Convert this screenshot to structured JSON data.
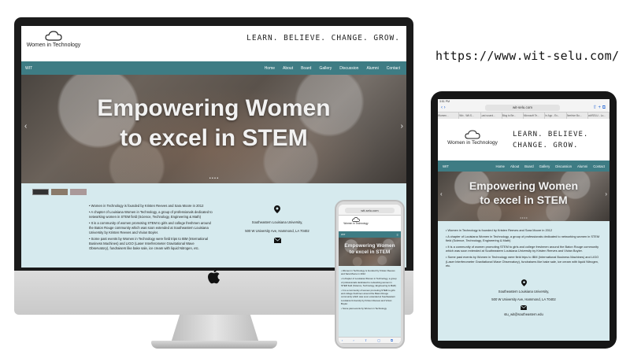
{
  "url": "https://www.wit-selu.com/",
  "site": {
    "logo_text": "Women in Technology",
    "tagline": "LEARN. BELIEVE. CHANGE. GROW.",
    "tagline_line1": "LEARN. BELIEVE.",
    "tagline_line2": "CHANGE. GROW.",
    "nav_brand": "WIT",
    "nav": [
      "Home",
      "About",
      "Board",
      "Gallery",
      "Discussion",
      "Alumni",
      "Contact"
    ],
    "hero_line1": "Empowering Women",
    "hero_line2": "to excel in STEM",
    "hero_prev": "‹",
    "hero_next": "›",
    "hero_dots": "• • • •",
    "bullets": [
      "Women in Technology is founded by Kristen Reeves and Sara Moore in 2012",
      "A chapter of Louisiana Women in Technology, a group of professionals dedicated to networking women in STEM field (Science, Technology, Engineering & Math)",
      "It is a community of women promoting STEM to girls and college freshmen around the Baton Rouge community which was soon extended at Southeastern Louisiana University by Kristen Reeves and Vivian Boyler.",
      "Some past events by Women in Technology were field trips to IBM (International Business Machines) and LIGO (Laser Interferometer Gravitational Wave Observatory), fundraisers like bake sale, ice cream with liquid Nitrogen, etc."
    ],
    "phone_bullets": [
      "Women in Technology is founded by Kristen Reeves and Sara Moore in 2012",
      "A chapter of Louisiana Women in Technology, a group of professionals dedicated to networking women in STEM field (Science, Technology, Engineering & Math)",
      "It is a community of women promoting STEM to girls and college freshmen around the Baton Rouge community which was soon extended at Southeastern Louisiana University by Kristen Reeves and Vivian Boyler.",
      "Some past events by Women in Technology"
    ],
    "contact_org": "Southeastern Louisiana University,",
    "contact_address": "500 W University Ave, Hammond, LA 70402",
    "contact_email": "stu_wit@southeastern.edu"
  },
  "ipad_browser": {
    "status_time": "3:51 PM",
    "address": "wit-selu.com",
    "tabs": [
      "Women...",
      "Wix - Wit.S...",
      "Last sound...",
      "Blog to Be...",
      "Microsoft Te...",
      "In App - Ev...",
      "Beehive Bu...",
      "wit/SELU - Lo..."
    ]
  },
  "iphone_browser": {
    "address": "wit-selu.com",
    "nav_brand": "WIT"
  },
  "colors": {
    "nav": "#3e7c84",
    "content_bg": "#d6eaee",
    "frame": "#1b1b1b"
  }
}
